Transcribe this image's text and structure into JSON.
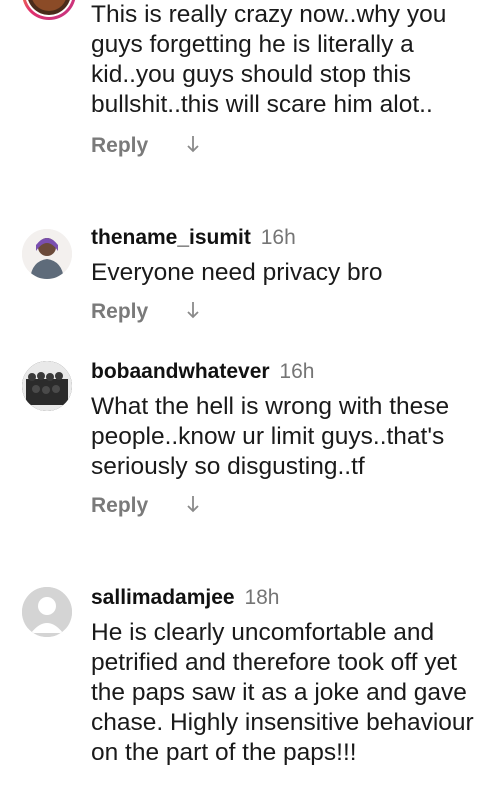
{
  "comments": [
    {
      "username": "",
      "time": "",
      "text": "This is really crazy now..why you guys forgetting he is literally a kid..you guys should stop this bullshit..this will scare him alot..",
      "reply_label": "Reply",
      "arrow_icon": "arrow-down-icon"
    },
    {
      "username": "thename_isumit",
      "time": "16h",
      "text": "Everyone need privacy bro",
      "reply_label": "Reply",
      "arrow_icon": "arrow-down-icon"
    },
    {
      "username": "bobaandwhatever",
      "time": "16h",
      "text": "What the hell is wrong with these people..know ur limit guys..that's seriously so disgusting..tf",
      "reply_label": "Reply",
      "arrow_icon": "arrow-down-icon"
    },
    {
      "username": "sallimadamjee",
      "time": "18h",
      "text": "He is clearly uncomfortable and petrified and therefore took off yet the paps saw it as a joke and gave chase. Highly insensitive behaviour on the part of the paps!!!",
      "reply_label": "Reply",
      "arrow_icon": "arrow-down-icon"
    }
  ],
  "colors": {
    "text": "#1a1a1a",
    "muted": "#757575",
    "story_ring_start": "#f9b234",
    "story_ring_end": "#c13584",
    "default_avatar": "#d4d4d4"
  }
}
